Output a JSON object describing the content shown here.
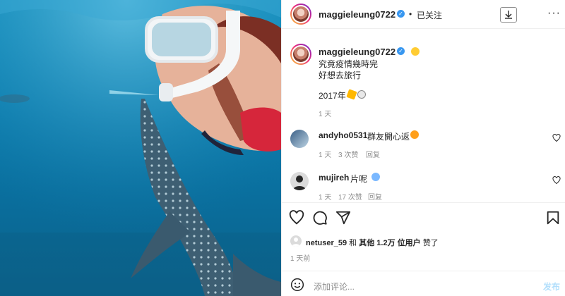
{
  "post": {
    "author": "maggieleung0722",
    "follow_separator": "•",
    "follow_label": "已关注",
    "more_label": "···",
    "caption": {
      "author": "maggieleung0722",
      "line1": "究竟疫情幾時完",
      "line2": "好想去旅行",
      "line3": "2017年",
      "time": "1 天"
    }
  },
  "comments": [
    {
      "author": "andyho0531",
      "text": "群友開心返",
      "time": "1 天",
      "likes": "3 次赞",
      "reply": "回复"
    },
    {
      "author": "mujireh",
      "text": "片呢",
      "time": "1 天",
      "likes": "17 次赞",
      "reply": "回复"
    }
  ],
  "likes": {
    "user": "netuser_59",
    "and": "和",
    "others": "其他 1.2万 位用户",
    "suffix": "赞了"
  },
  "post_date": "1 天前",
  "comment_box": {
    "placeholder": "添加评论...",
    "publish": "发布"
  },
  "colors": {
    "link_blue": "#b2dffc",
    "verified_blue": "#3897f0",
    "muted": "#8e8e8e"
  },
  "icons": [
    "download-icon",
    "more-icon",
    "verified-icon",
    "heart-icon",
    "comment-icon",
    "share-icon",
    "bookmark-icon",
    "smile-icon"
  ]
}
